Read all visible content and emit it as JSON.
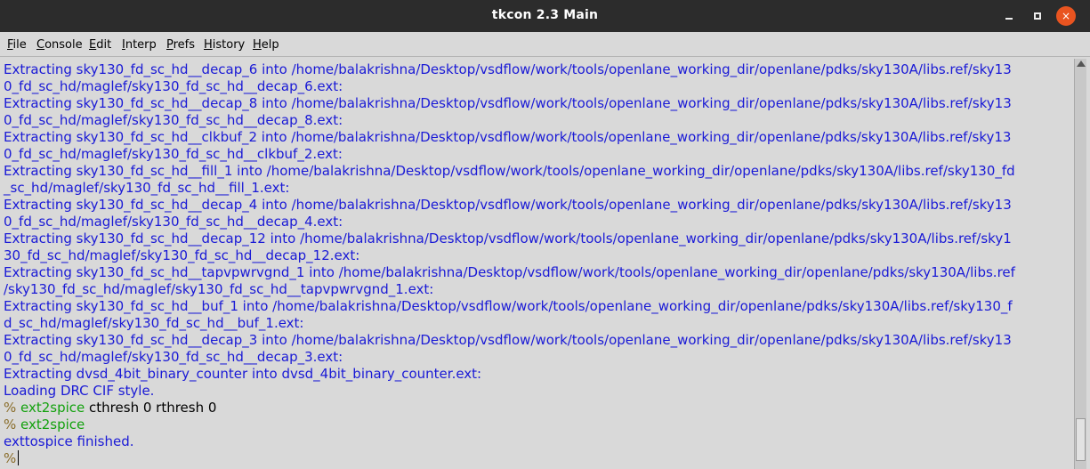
{
  "window": {
    "title": "tkcon 2.3 Main",
    "controls": {
      "minimize": "minimize",
      "maximize": "maximize",
      "close": "×"
    }
  },
  "menu": {
    "items": [
      {
        "label": "File",
        "mnemonic": "F"
      },
      {
        "label": "Console",
        "mnemonic": "C"
      },
      {
        "label": "Edit",
        "mnemonic": "E"
      },
      {
        "label": "Interp",
        "mnemonic": "I"
      },
      {
        "label": "Prefs",
        "mnemonic": "P"
      },
      {
        "label": "History",
        "mnemonic": "H"
      },
      {
        "label": "Help",
        "mnemonic": "H"
      }
    ]
  },
  "console": {
    "lines": [
      {
        "type": "stdout",
        "text": "Extracting sky130_fd_sc_hd__decap_6 into /home/balakrishna/Desktop/vsdflow/work/tools/openlane_working_dir/openlane/pdks/sky130A/libs.ref/sky13"
      },
      {
        "type": "stdout",
        "text": "0_fd_sc_hd/maglef/sky130_fd_sc_hd__decap_6.ext:"
      },
      {
        "type": "stdout",
        "text": "Extracting sky130_fd_sc_hd__decap_8 into /home/balakrishna/Desktop/vsdflow/work/tools/openlane_working_dir/openlane/pdks/sky130A/libs.ref/sky13"
      },
      {
        "type": "stdout",
        "text": "0_fd_sc_hd/maglef/sky130_fd_sc_hd__decap_8.ext:"
      },
      {
        "type": "stdout",
        "text": "Extracting sky130_fd_sc_hd__clkbuf_2 into /home/balakrishna/Desktop/vsdflow/work/tools/openlane_working_dir/openlane/pdks/sky130A/libs.ref/sky13"
      },
      {
        "type": "stdout",
        "text": "0_fd_sc_hd/maglef/sky130_fd_sc_hd__clkbuf_2.ext:"
      },
      {
        "type": "stdout",
        "text": "Extracting sky130_fd_sc_hd__fill_1 into /home/balakrishna/Desktop/vsdflow/work/tools/openlane_working_dir/openlane/pdks/sky130A/libs.ref/sky130_fd"
      },
      {
        "type": "stdout",
        "text": "_sc_hd/maglef/sky130_fd_sc_hd__fill_1.ext:"
      },
      {
        "type": "stdout",
        "text": "Extracting sky130_fd_sc_hd__decap_4 into /home/balakrishna/Desktop/vsdflow/work/tools/openlane_working_dir/openlane/pdks/sky130A/libs.ref/sky13"
      },
      {
        "type": "stdout",
        "text": "0_fd_sc_hd/maglef/sky130_fd_sc_hd__decap_4.ext:"
      },
      {
        "type": "stdout",
        "text": "Extracting sky130_fd_sc_hd__decap_12 into /home/balakrishna/Desktop/vsdflow/work/tools/openlane_working_dir/openlane/pdks/sky130A/libs.ref/sky1"
      },
      {
        "type": "stdout",
        "text": "30_fd_sc_hd/maglef/sky130_fd_sc_hd__decap_12.ext:"
      },
      {
        "type": "stdout",
        "text": "Extracting sky130_fd_sc_hd__tapvpwrvgnd_1 into /home/balakrishna/Desktop/vsdflow/work/tools/openlane_working_dir/openlane/pdks/sky130A/libs.ref"
      },
      {
        "type": "stdout",
        "text": "/sky130_fd_sc_hd/maglef/sky130_fd_sc_hd__tapvpwrvgnd_1.ext:"
      },
      {
        "type": "stdout",
        "text": "Extracting sky130_fd_sc_hd__buf_1 into /home/balakrishna/Desktop/vsdflow/work/tools/openlane_working_dir/openlane/pdks/sky130A/libs.ref/sky130_f"
      },
      {
        "type": "stdout",
        "text": "d_sc_hd/maglef/sky130_fd_sc_hd__buf_1.ext:"
      },
      {
        "type": "stdout",
        "text": "Extracting sky130_fd_sc_hd__decap_3 into /home/balakrishna/Desktop/vsdflow/work/tools/openlane_working_dir/openlane/pdks/sky130A/libs.ref/sky13"
      },
      {
        "type": "stdout",
        "text": "0_fd_sc_hd/maglef/sky130_fd_sc_hd__decap_3.ext:"
      },
      {
        "type": "stdout",
        "text": "Extracting dvsd_4bit_binary_counter into dvsd_4bit_binary_counter.ext:"
      },
      {
        "type": "stdout",
        "text": "Loading DRC CIF style."
      },
      {
        "type": "prompt",
        "prompt": "% ",
        "command": "ext2spice",
        "args": " cthresh 0 rthresh 0"
      },
      {
        "type": "prompt",
        "prompt": "% ",
        "command": "ext2spice",
        "args": ""
      },
      {
        "type": "stdout",
        "text": "exttospice finished."
      },
      {
        "type": "input",
        "prompt": "%",
        "command": "",
        "args": ""
      }
    ]
  },
  "colors": {
    "stdout": "#1a1ad6",
    "prompt": "#8a6d2a",
    "command": "#13a10e",
    "titlebar": "#2c2c2c",
    "close_button": "#e95420",
    "background": "#d9d9d9"
  }
}
